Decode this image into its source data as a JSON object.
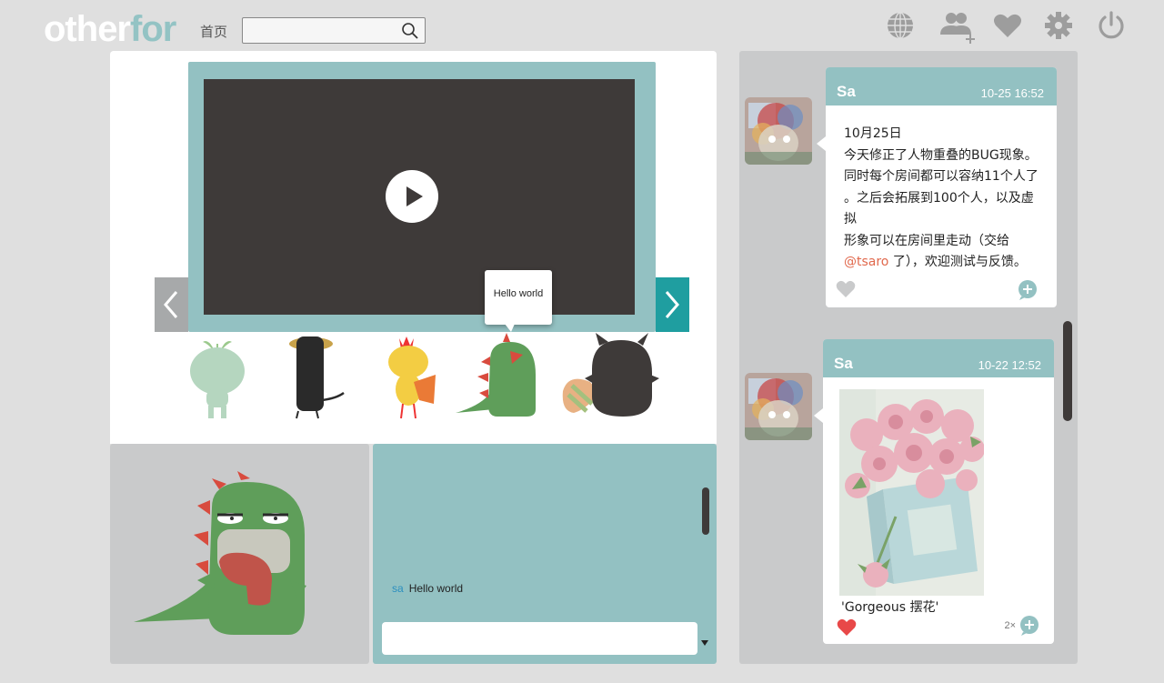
{
  "header": {
    "logo_part1": "other",
    "logo_part2": "for",
    "home_label": "首页",
    "search_placeholder": "",
    "icons": [
      "globe-icon",
      "add-friends-icon",
      "heart-icon",
      "gear-icon",
      "power-icon"
    ]
  },
  "player": {
    "tooltip": "Hello world"
  },
  "characters": [
    "sprout-character",
    "black-hat-character",
    "yellow-chick-character",
    "green-dino-character",
    "black-monster-character"
  ],
  "chat": {
    "messages": [
      {
        "user": "sa",
        "text": "Hello world"
      }
    ],
    "input_value": ""
  },
  "feed": {
    "posts": [
      {
        "user": "Sa",
        "time": "10-25 16:52",
        "lines": [
          "10月25日",
          "今天修正了人物重叠的BUG现象。",
          "同时每个房间都可以容纳11个人了",
          "。之后会拓展到100个人，以及虚拟",
          "形象可以在房间里走动（交给"
        ],
        "mention": "@tsaro",
        "tail": " 了），欢迎测试与反馈。"
      },
      {
        "user": "Sa",
        "time": "10-22 12:52",
        "caption": "'Gorgeous 摆花'",
        "likes": "2×"
      }
    ]
  },
  "colors": {
    "accent_teal": "#93c1c2",
    "arrow_active": "#1f9ea0",
    "mention": "#e1694d",
    "liked_heart": "#e84848"
  }
}
